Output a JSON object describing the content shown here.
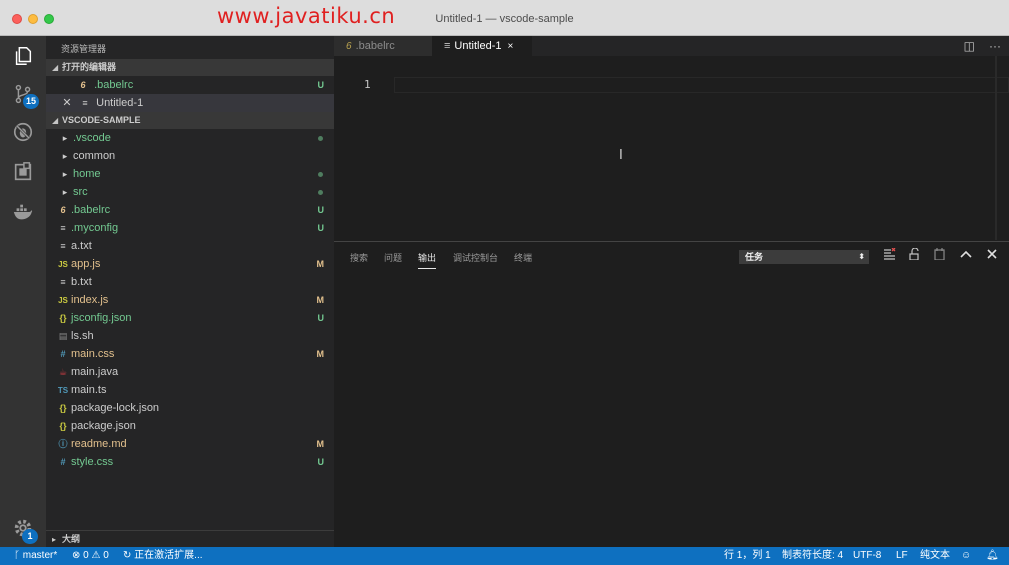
{
  "window": {
    "title": "Untitled-1 — vscode-sample",
    "watermark": "www.javatiku.cn"
  },
  "activity": {
    "scm_badge": "15",
    "settings_badge": "1"
  },
  "sidebar": {
    "title": "资源管理器",
    "open_editors_header": "打开的编辑器",
    "open_editors": [
      {
        "name": ".babelrc",
        "status": "U"
      },
      {
        "name": "Untitled-1"
      }
    ],
    "folder_header": "VSCODE-SAMPLE",
    "files": [
      {
        "name": ".vscode",
        "icon": "›"
      },
      {
        "name": "common",
        "icon": "›"
      },
      {
        "name": "home",
        "icon": "›"
      },
      {
        "name": "src",
        "icon": "›"
      },
      {
        "name": ".babelrc",
        "icon": "6",
        "status": "U"
      },
      {
        "name": ".myconfig",
        "icon": "≡",
        "status": "U"
      },
      {
        "name": "a.txt",
        "icon": "≡"
      },
      {
        "name": "app.js",
        "icon": "JS",
        "status": "M"
      },
      {
        "name": "b.txt",
        "icon": "≡"
      },
      {
        "name": "index.js",
        "icon": "JS",
        "status": "M"
      },
      {
        "name": "jsconfig.json",
        "icon": "{}",
        "status": "U"
      },
      {
        "name": "ls.sh",
        "icon": "▤"
      },
      {
        "name": "main.css",
        "icon": "#",
        "status": "M"
      },
      {
        "name": "main.java",
        "icon": "☕"
      },
      {
        "name": "main.ts",
        "icon": "TS"
      },
      {
        "name": "package-lock.json",
        "icon": "{}"
      },
      {
        "name": "package.json",
        "icon": "{}"
      },
      {
        "name": "readme.md",
        "icon": "ⓘ",
        "status": "M"
      },
      {
        "name": "style.css",
        "icon": "#",
        "status": "U"
      }
    ],
    "outline_header": "大纲"
  },
  "tabs": [
    {
      "label": ".babelrc",
      "icon": "6"
    },
    {
      "label": "Untitled-1",
      "icon": "≡",
      "close": "×"
    }
  ],
  "editor": {
    "line_number": "1"
  },
  "panel": {
    "tabs": [
      "搜索",
      "问题",
      "输出",
      "调试控制台",
      "终端"
    ],
    "active_tab": "输出",
    "task_select": "任务"
  },
  "statusbar": {
    "branch": "master*",
    "errors": "0",
    "warnings": "0",
    "activity": "正在激活扩展...",
    "position": "行 1，列 1",
    "indent": "制表符长度: 4",
    "encoding": "UTF-8",
    "eol": "LF",
    "language": "纯文本"
  },
  "colors": {
    "accent": "#0e70c0",
    "untracked": "#73c991",
    "modified": "#e2c08d"
  }
}
